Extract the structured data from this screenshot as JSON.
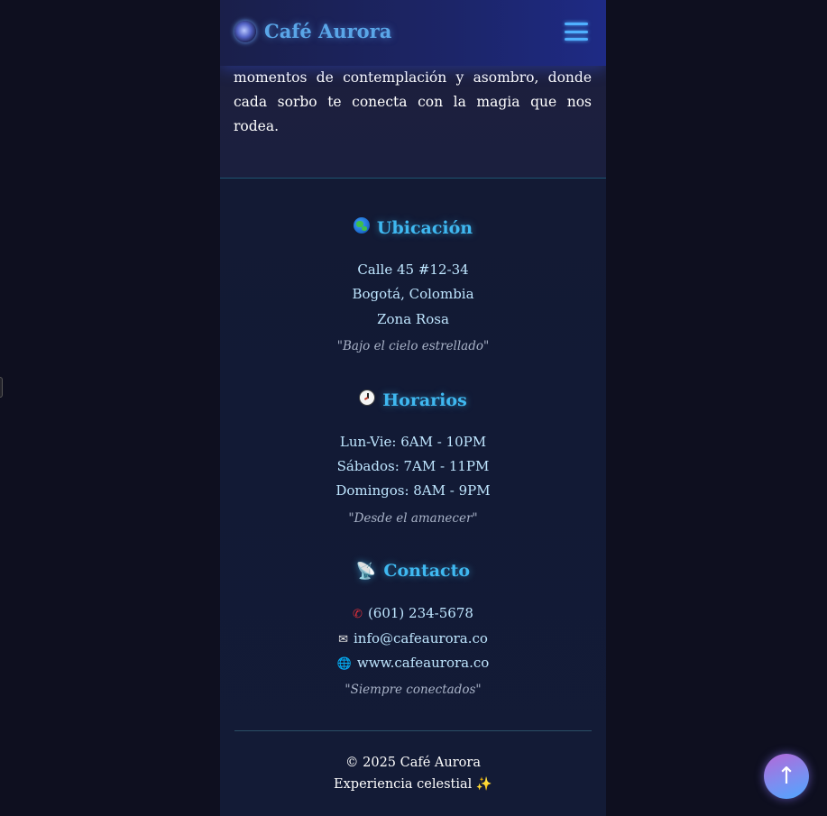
{
  "header": {
    "brand_name": "Café Aurora",
    "brand_icon": "galaxy-icon",
    "menu_icon": "hamburger-menu-icon"
  },
  "intro": {
    "text": "momentos de contemplación y asombro, donde cada sorbo te conecta con la magia que nos rodea."
  },
  "location": {
    "icon": "globe-icon",
    "title": "Ubicación",
    "lines": [
      "Calle 45 #12-34",
      "Bogotá, Colombia",
      "Zona Rosa"
    ],
    "quote": "\"Bajo el cielo estrellado\""
  },
  "hours": {
    "icon": "clock-icon",
    "title": "Horarios",
    "lines": [
      "Lun-Vie: 6AM - 10PM",
      "Sábados: 7AM - 11PM",
      "Domingos: 8AM - 9PM"
    ],
    "quote": "\"Desde el amanecer\""
  },
  "contact": {
    "icon": "satellite-dish-icon",
    "title": "Contacto",
    "phone": "(601) 234-5678",
    "email": "info@cafeaurora.co",
    "website": "www.cafeaurora.co",
    "quote": "\"Siempre conectados\""
  },
  "footer": {
    "copyright": "© 2025 Café Aurora",
    "tagline": "Experiencia celestial ✨"
  },
  "scroll_top": {
    "label": "↑",
    "icon": "arrow-up-icon"
  },
  "colors": {
    "accent": "#3fb8f0",
    "background": "#0e0f1f",
    "header": "#1e2a85"
  }
}
